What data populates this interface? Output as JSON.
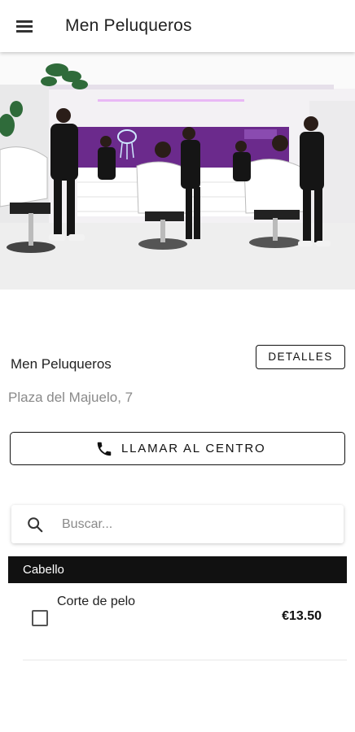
{
  "appbar": {
    "title": "Men Peluqueros",
    "menu_icon": "hamburger-menu-icon"
  },
  "hero": {
    "description_icon": "salon-photo"
  },
  "shop": {
    "name": "Men Peluqueros",
    "details_label": "DETALLES",
    "address": "Plaza del Majuelo, 7",
    "call_label": "LLAMAR AL CENTRO",
    "call_icon": "phone-icon"
  },
  "search": {
    "placeholder": "Buscar...",
    "value": "",
    "icon": "search-icon"
  },
  "categories": [
    {
      "name": "Cabello",
      "services": [
        {
          "name": "Corte de pelo",
          "price": "€13.50",
          "checked": false
        }
      ]
    }
  ],
  "colors": {
    "accent": "#111111",
    "purple_wall": "#6b2a8c"
  }
}
